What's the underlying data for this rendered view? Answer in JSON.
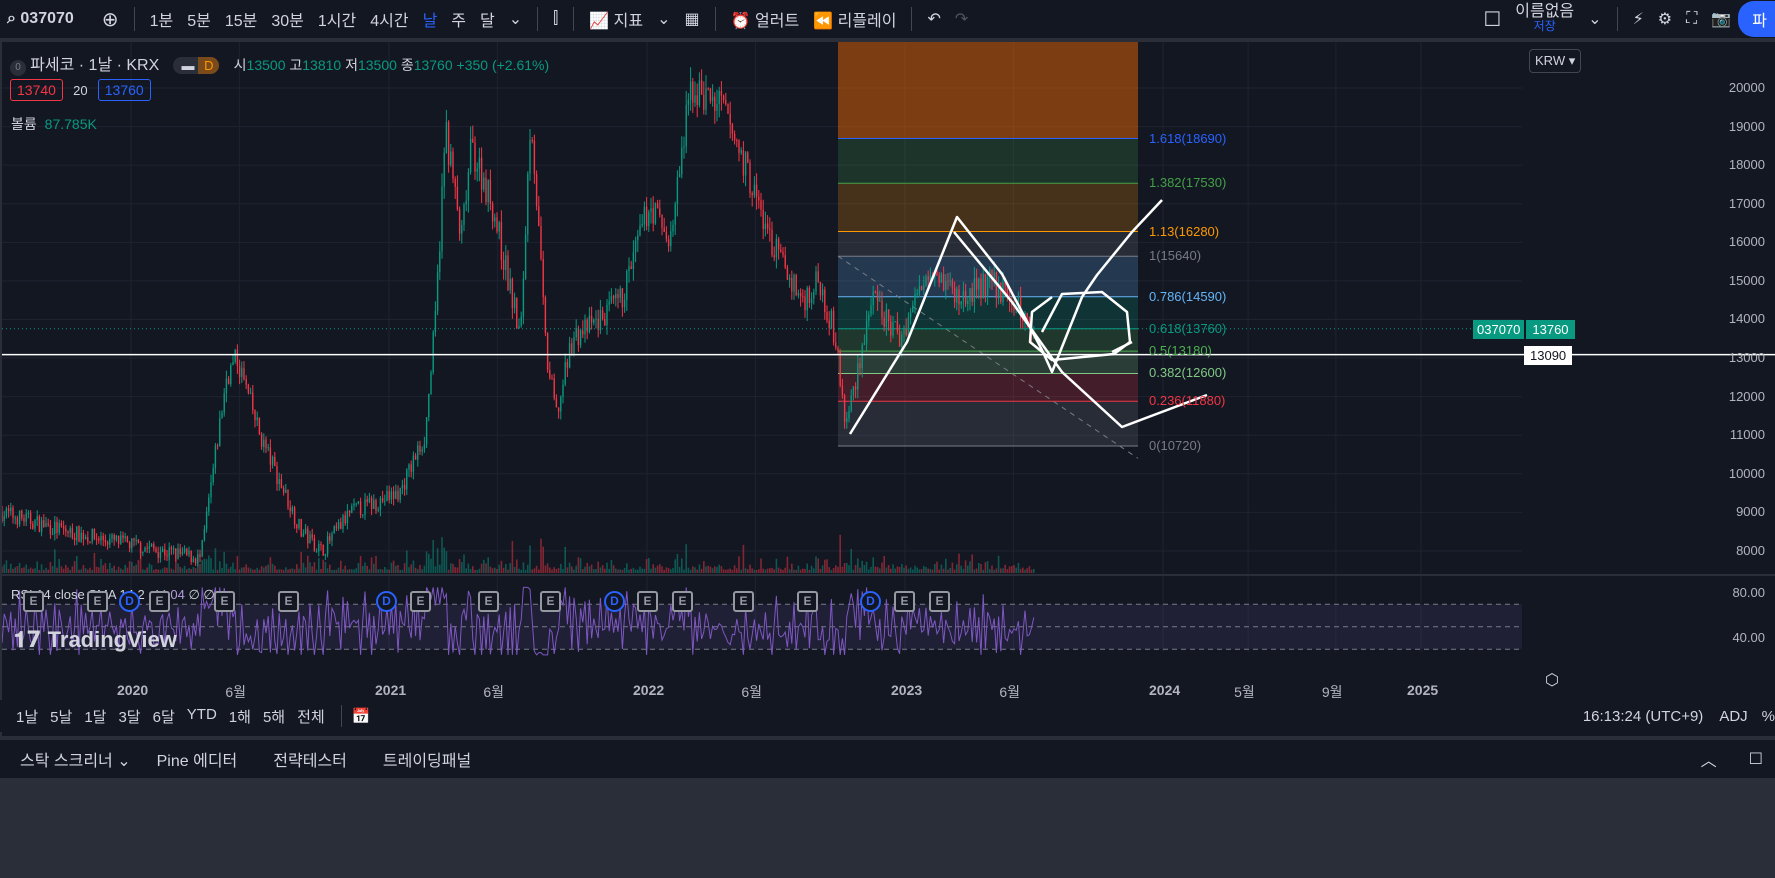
{
  "toolbar": {
    "symbol": "037070",
    "intervals": [
      "1분",
      "5분",
      "15분",
      "30분",
      "1시간",
      "4시간",
      "날",
      "주",
      "달"
    ],
    "active_interval": "날",
    "indicators": "지표",
    "alert": "얼러트",
    "replay": "리플레이",
    "layout_name": "이름없음",
    "save": "저장",
    "publish": "파"
  },
  "legend": {
    "title": "파세코 · 1날 · KRX",
    "d_badge": "D",
    "open_label": "시",
    "open": "13500",
    "high_label": "고",
    "high": "13810",
    "low_label": "저",
    "low": "13500",
    "close_label": "종",
    "close": "13760",
    "change": "+350 (+2.61%)",
    "bid": "13740",
    "spread": "20",
    "ask": "13760",
    "volume_label": "볼륨",
    "volume": "87.785K",
    "rsi": "RSI 14 close SMA 14 2",
    "rsi_value": "44.04",
    "rsi_extra": "∅ ∅"
  },
  "currency": "KRW",
  "colors": {
    "up": "#089981",
    "down": "#f23645",
    "accent": "#2962ff",
    "rsi": "#7e57c2"
  },
  "price_axis": {
    "ticks": [
      "20000",
      "19000",
      "18000",
      "17000",
      "16000",
      "15000",
      "14000",
      "13000",
      "12000",
      "11000",
      "10000",
      "9000",
      "8000"
    ],
    "last_symbol": "037070",
    "last_price": "13760",
    "hline_price": "13090"
  },
  "rsi_axis": [
    "80.00",
    "40.00"
  ],
  "time_axis": [
    "2020",
    "6월",
    "2021",
    "6월",
    "2022",
    "6월",
    "2023",
    "6월",
    "2024",
    "5월",
    "9월",
    "2025"
  ],
  "fib": [
    {
      "label": "1.618(18690)",
      "p": 18690,
      "c": "#2962ff"
    },
    {
      "label": "1.382(17530)",
      "p": 17530,
      "c": "#43a047"
    },
    {
      "label": "1.13(16280)",
      "p": 16280,
      "c": "#ff9800"
    },
    {
      "label": "1(15640)",
      "p": 15640,
      "c": "#787b86"
    },
    {
      "label": "0.786(14590)",
      "p": 14590,
      "c": "#64b5f6"
    },
    {
      "label": "0.618(13760)",
      "p": 13760,
      "c": "#089981"
    },
    {
      "label": "0.5(13180)",
      "p": 13180,
      "c": "#4caf50"
    },
    {
      "label": "0.382(12600)",
      "p": 12600,
      "c": "#81c784"
    },
    {
      "label": "0.236(11880)",
      "p": 11880,
      "c": "#f23645"
    },
    {
      "label": "0(10720)",
      "p": 10720,
      "c": "#787b86"
    }
  ],
  "events": [
    "E",
    "E",
    "D",
    "E",
    "E",
    "E",
    "D",
    "E",
    "E",
    "E",
    "D",
    "E",
    "E",
    "E",
    "E",
    "D",
    "E",
    "E"
  ],
  "watermark": "TradingView",
  "range_buttons": [
    "1날",
    "5날",
    "1달",
    "3달",
    "6달",
    "YTD",
    "1해",
    "5해",
    "전체"
  ],
  "clock": "16:13:24 (UTC+9)",
  "adj": "ADJ",
  "pct": "%",
  "bottom_tabs": [
    "스탁 스크리너",
    "Pine 에디터",
    "전략테스터",
    "트레이딩패널"
  ],
  "chart_data": {
    "type": "candlestick",
    "symbol": "037070",
    "ylim": [
      7500,
      20500
    ],
    "waypoints_year_price": [
      [
        2019.5,
        9000
      ],
      [
        2019.75,
        8500
      ],
      [
        2020.27,
        7800
      ],
      [
        2020.37,
        12500
      ],
      [
        2020.41,
        13000
      ],
      [
        2020.5,
        11000
      ],
      [
        2020.66,
        8500
      ],
      [
        2020.74,
        8000
      ],
      [
        2020.85,
        9000
      ],
      [
        2021.04,
        9500
      ],
      [
        2021.14,
        11000
      ],
      [
        2021.18,
        14000
      ],
      [
        2021.22,
        19000
      ],
      [
        2021.28,
        16000
      ],
      [
        2021.32,
        18500
      ],
      [
        2021.4,
        17000
      ],
      [
        2021.51,
        13500
      ],
      [
        2021.55,
        19500
      ],
      [
        2021.61,
        13000
      ],
      [
        2021.65,
        11500
      ],
      [
        2021.71,
        13500
      ],
      [
        2021.82,
        14000
      ],
      [
        2021.9,
        14500
      ],
      [
        2022.01,
        17000
      ],
      [
        2022.09,
        16000
      ],
      [
        2022.17,
        20000
      ],
      [
        2022.29,
        19500
      ],
      [
        2022.38,
        18000
      ],
      [
        2022.48,
        16000
      ],
      [
        2022.6,
        14500
      ],
      [
        2022.67,
        15000
      ],
      [
        2022.73,
        13500
      ],
      [
        2022.77,
        11200
      ],
      [
        2022.87,
        14500
      ],
      [
        2022.98,
        13500
      ],
      [
        2023.1,
        15500
      ],
      [
        2023.21,
        14500
      ],
      [
        2023.33,
        15000
      ],
      [
        2023.41,
        14500
      ],
      [
        2023.5,
        13760
      ]
    ]
  }
}
